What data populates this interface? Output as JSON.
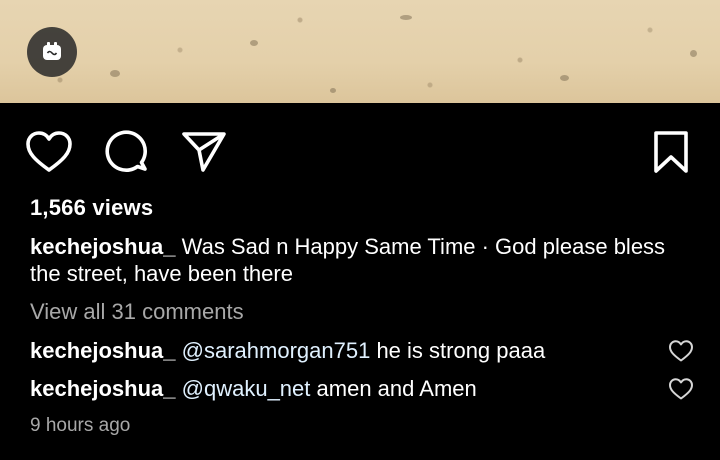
{
  "post": {
    "views": "1,566 views",
    "caption_user": "kechejoshua_",
    "caption_text": "Was Sad n Happy Same Time · God please bless the street, have been there",
    "view_all_comments": "View all 31 comments",
    "timestamp": "9 hours ago"
  },
  "comments": [
    {
      "user": "kechejoshua_",
      "mention": "@sarahmorgan751",
      "text": "he is strong paaa"
    },
    {
      "user": "kechejoshua_",
      "mention": "@qwaku_net",
      "text": "amen and Amen"
    }
  ],
  "icons": {
    "reel": "reel-icon",
    "like": "heart-icon",
    "comment": "comment-bubble-icon",
    "share": "paper-plane-icon",
    "save": "bookmark-icon",
    "comment_like": "heart-icon"
  },
  "colors": {
    "background": "#000000",
    "text": "#ffffff",
    "muted": "#a8a8a8",
    "mention": "#e0f1ff",
    "media_sand": "#e4d0aa"
  }
}
